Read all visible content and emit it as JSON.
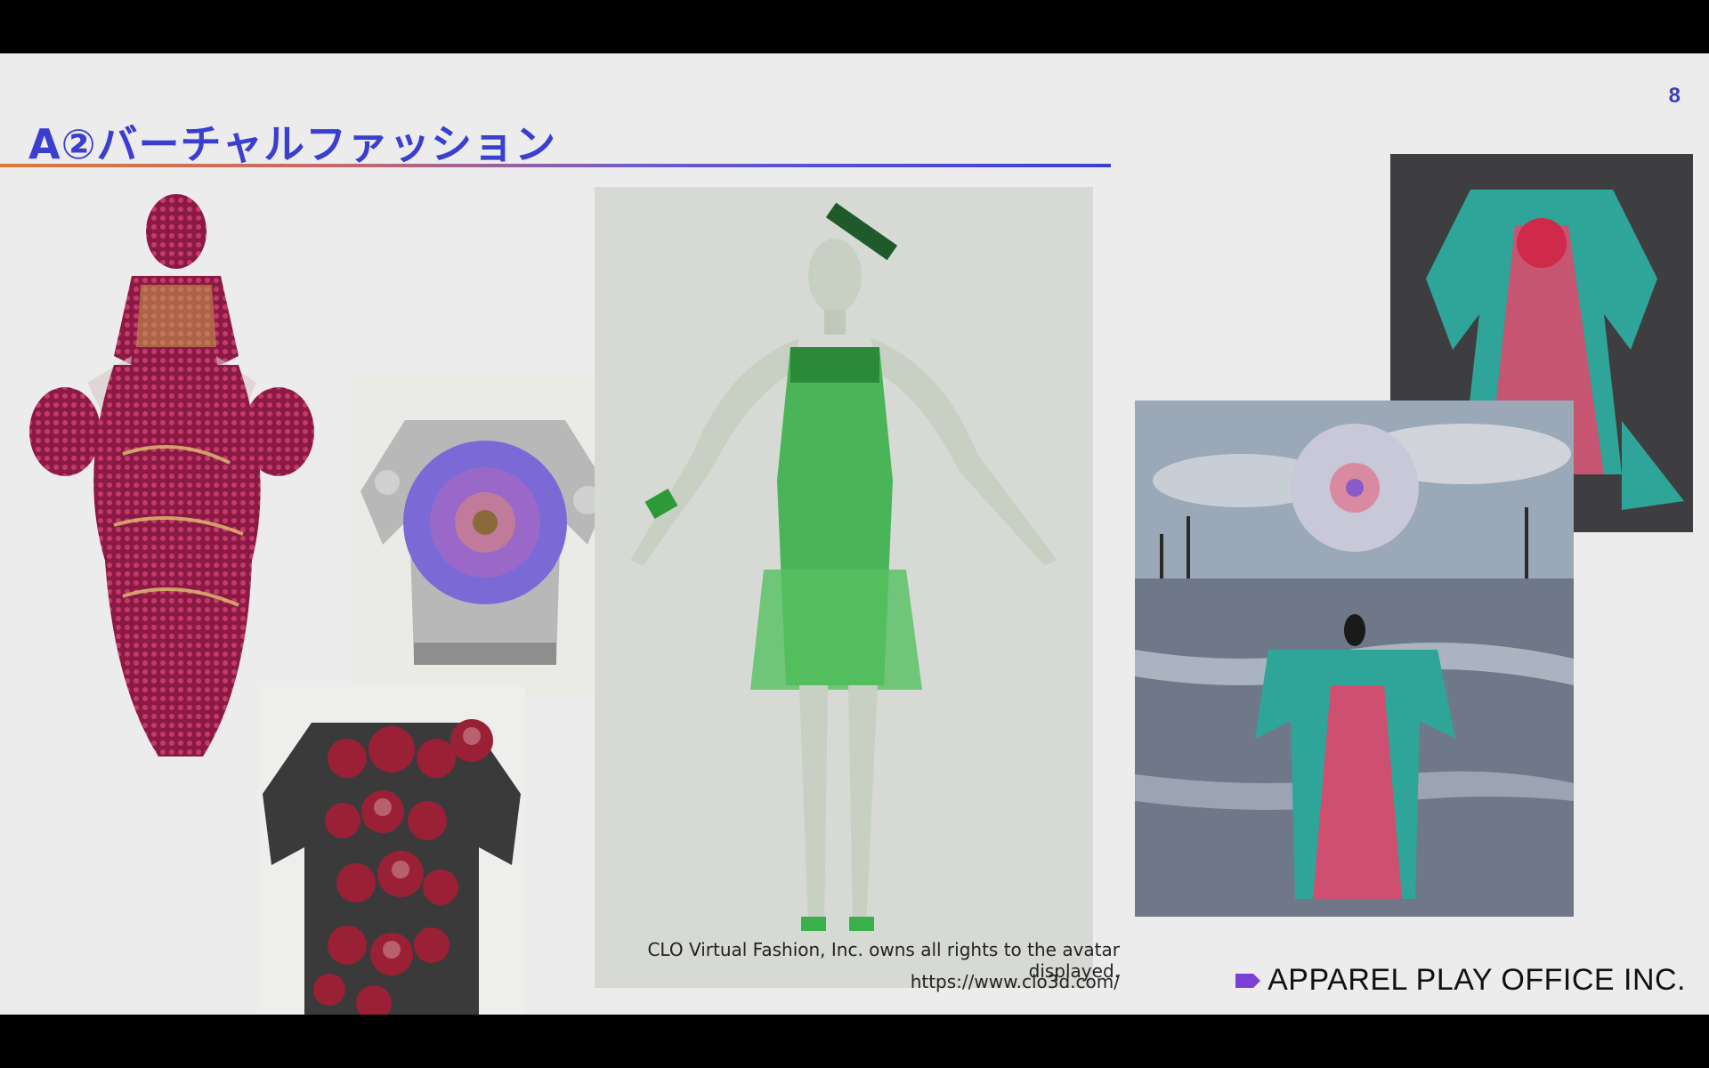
{
  "slide": {
    "page_number": "8",
    "title": "A②バーチャルファッション",
    "caption_rights": "CLO Virtual Fashion, Inc. owns all rights to the avatar displayed.",
    "caption_url": "https://www.clo3d.com/",
    "company_name": "APPAREL PLAY OFFICE INC."
  },
  "images": [
    {
      "name": "ruffled-pink-gown-image",
      "subject": "pink ruffled gown with gold threads"
    },
    {
      "name": "flower-sweater-image",
      "subject": "silver sweater with purple flower"
    },
    {
      "name": "red-ruffle-top-image",
      "subject": "black top with red ruffles"
    },
    {
      "name": "green-avatar-dress-image",
      "subject": "avatar in translucent green dress"
    },
    {
      "name": "kimono-render-image",
      "subject": "teal kimono with red sash"
    },
    {
      "name": "lake-scene-image",
      "subject": "figure in kimono on lake with sphere"
    }
  ],
  "colors": {
    "title": "#3b3fd0",
    "accent": "#7b3fd8",
    "background": "#ececec"
  }
}
